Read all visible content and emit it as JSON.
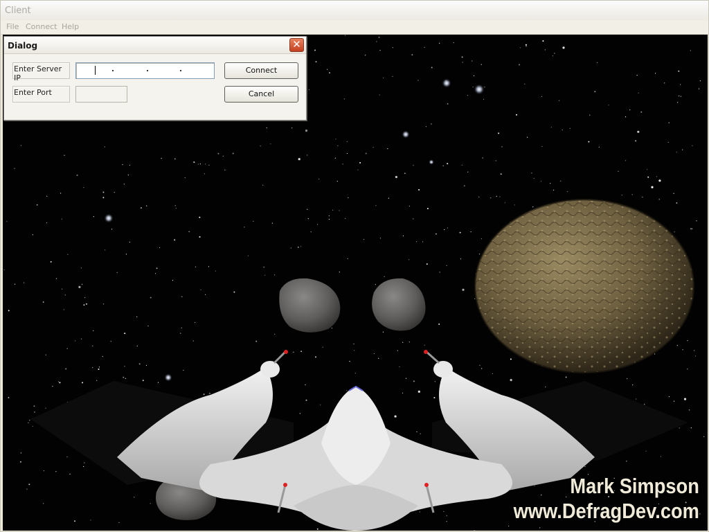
{
  "window": {
    "title": "Client"
  },
  "menu": {
    "items": [
      {
        "label": "File"
      },
      {
        "label": "Connect"
      },
      {
        "label": "Help"
      }
    ]
  },
  "dialog": {
    "title": "Dialog",
    "close_glyph": "✕",
    "server_ip_label": "Enter Server IP",
    "server_ip_value": "",
    "port_label": "Enter Port",
    "port_value": "",
    "connect_label": "Connect",
    "cancel_label": "Cancel"
  },
  "scene": {
    "watermark_name": "Mark Simpson",
    "watermark_url": "www.DefragDev.com",
    "objects": [
      "starfield",
      "planet",
      "asteroid",
      "asteroid",
      "spaceship"
    ]
  },
  "colors": {
    "close_button": "#d4502c",
    "menu_text_disabled": "#a8a69c",
    "window_bg": "#ece9d8",
    "space": "#020202",
    "planet": "#7a6a45",
    "ship": "#d8d8d8"
  }
}
